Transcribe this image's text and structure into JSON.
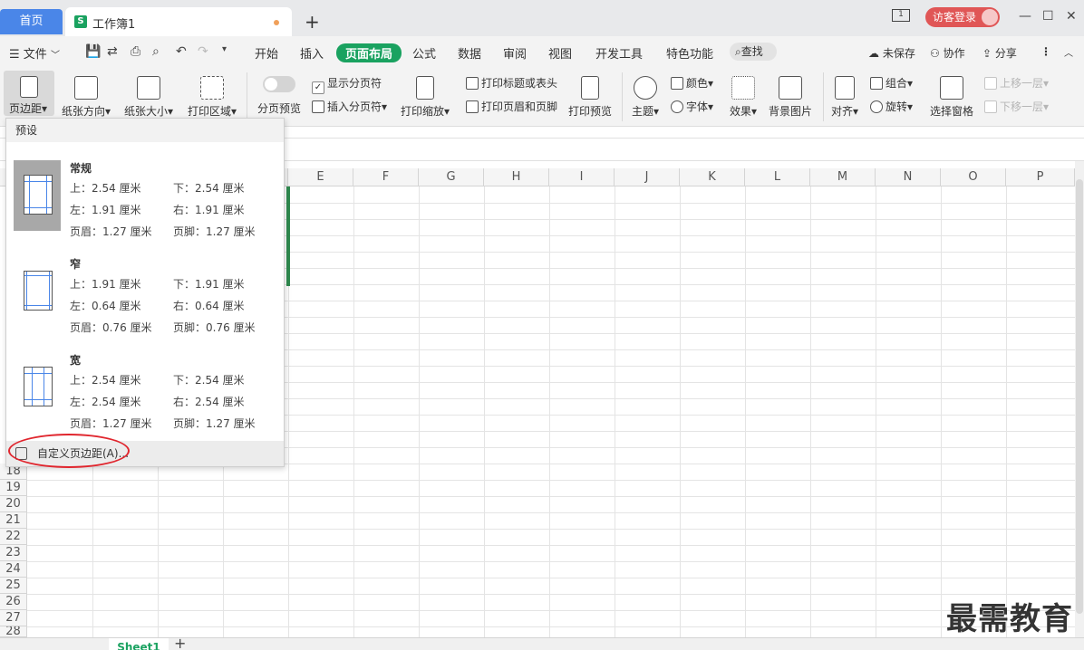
{
  "titlebar": {
    "home_tab": "首页",
    "doc_tab": "工作簿1",
    "doc_icon": "S",
    "new_tab": "+",
    "login": "访客登录",
    "page_indicator": "1"
  },
  "menubar": {
    "file": "文件",
    "tabs": [
      "开始",
      "插入",
      "页面布局",
      "公式",
      "数据",
      "审阅",
      "视图",
      "开发工具",
      "特色功能"
    ],
    "active_tab": "页面布局",
    "search": "查找",
    "unsaved": "未保存",
    "collab": "协作",
    "share": "分享"
  },
  "ribbon": {
    "margins": "页边距",
    "orientation": "纸张方向",
    "size": "纸张大小",
    "print_area": "打印区域",
    "page_break_preview": "分页预览",
    "show_page_breaks": "显示分页符",
    "insert_page_break": "插入分页符",
    "print_scale": "打印缩放",
    "print_titles": "打印标题或表头",
    "print_header_footer": "打印页眉和页脚",
    "print_preview": "打印预览",
    "theme": "主题",
    "colors": "颜色",
    "fonts": "字体",
    "effects": "效果",
    "background": "背景图片",
    "align": "对齐",
    "group": "组合",
    "rotate": "旋转",
    "selection_pane": "选择窗格",
    "bring_forward": "上移一层",
    "send_backward": "下移一层"
  },
  "grid": {
    "columns": [
      "E",
      "F",
      "G",
      "H",
      "I",
      "J",
      "K",
      "L",
      "M",
      "N",
      "O",
      "P"
    ],
    "rows": [
      "18",
      "19",
      "20",
      "21",
      "22",
      "23",
      "24",
      "25",
      "26",
      "27",
      "28"
    ]
  },
  "margin_panel": {
    "header": "预设",
    "presets": [
      {
        "name": "常规",
        "top": "上：2.54 厘米",
        "bottom": "下：2.54 厘米",
        "left": "左：1.91 厘米",
        "right": "右：1.91 厘米",
        "header": "页眉：1.27 厘米",
        "footer": "页脚：1.27 厘米"
      },
      {
        "name": "窄",
        "top": "上：1.91 厘米",
        "bottom": "下：1.91 厘米",
        "left": "左：0.64 厘米",
        "right": "右：0.64 厘米",
        "header": "页眉：0.76 厘米",
        "footer": "页脚：0.76 厘米"
      },
      {
        "name": "宽",
        "top": "上：2.54 厘米",
        "bottom": "下：2.54 厘米",
        "left": "左：2.54 厘米",
        "right": "右：2.54 厘米",
        "header": "页眉：1.27 厘米",
        "footer": "页脚：1.27 厘米"
      }
    ],
    "custom": "自定义页边距(A)..."
  },
  "sheets": {
    "active": "Sheet1",
    "add": "+"
  },
  "watermark": "最需教育",
  "colors": {
    "accent": "#1aa260",
    "home_tab": "#4a86e8",
    "highlight_ring": "#e0262e"
  }
}
